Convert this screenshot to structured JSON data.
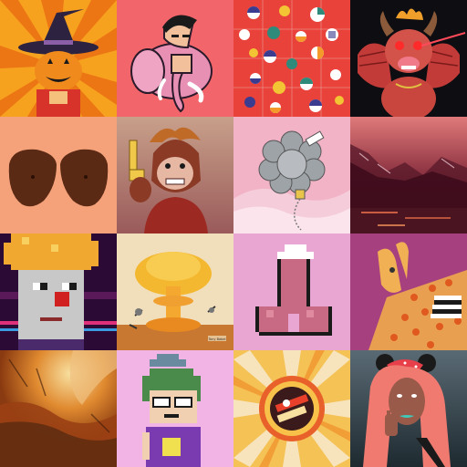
{
  "grid": {
    "rows": 4,
    "cols": 4,
    "tiles": [
      {
        "name": "pumpkin-witch-tile",
        "bg": "#f59a1c",
        "interactable": true
      },
      {
        "name": "pink-elephant-man-tile",
        "bg": "#f2646a",
        "interactable": true
      },
      {
        "name": "geometric-circles-tile",
        "bg": "#e8403a",
        "interactable": true
      },
      {
        "name": "red-dragon-tile",
        "bg": "#0d0d12",
        "interactable": true
      },
      {
        "name": "brown-shapes-tile",
        "bg": "#f5a07a",
        "interactable": true
      },
      {
        "name": "ape-with-gun-tile",
        "bg": "#c9a38f",
        "interactable": true
      },
      {
        "name": "grey-flower-balloon-tile",
        "bg": "#f3b4c6",
        "interactable": true
      },
      {
        "name": "pink-mountain-lake-tile",
        "bg": "#8a2f3b",
        "interactable": true
      },
      {
        "name": "pixel-punk-tile",
        "bg": "#2b0b36",
        "interactable": true
      },
      {
        "name": "mushroom-cloud-tile",
        "bg": "#f1dfbd",
        "interactable": true
      },
      {
        "name": "pixel-pink-shape-tile",
        "bg": "#e9a5d3",
        "interactable": true
      },
      {
        "name": "hand-pattern-tile",
        "bg": "#a7407f",
        "interactable": true
      },
      {
        "name": "abstract-painting-tile",
        "bg": "#b05a1e",
        "interactable": true
      },
      {
        "name": "pixel-character-tile",
        "bg": "#f2b4e4",
        "interactable": true
      },
      {
        "name": "sunburst-badge-tile",
        "bg": "#f4c255",
        "interactable": true
      },
      {
        "name": "pink-hair-girl-tile",
        "bg": "#37474f",
        "interactable": true
      }
    ]
  },
  "signature": "Tony Babel"
}
